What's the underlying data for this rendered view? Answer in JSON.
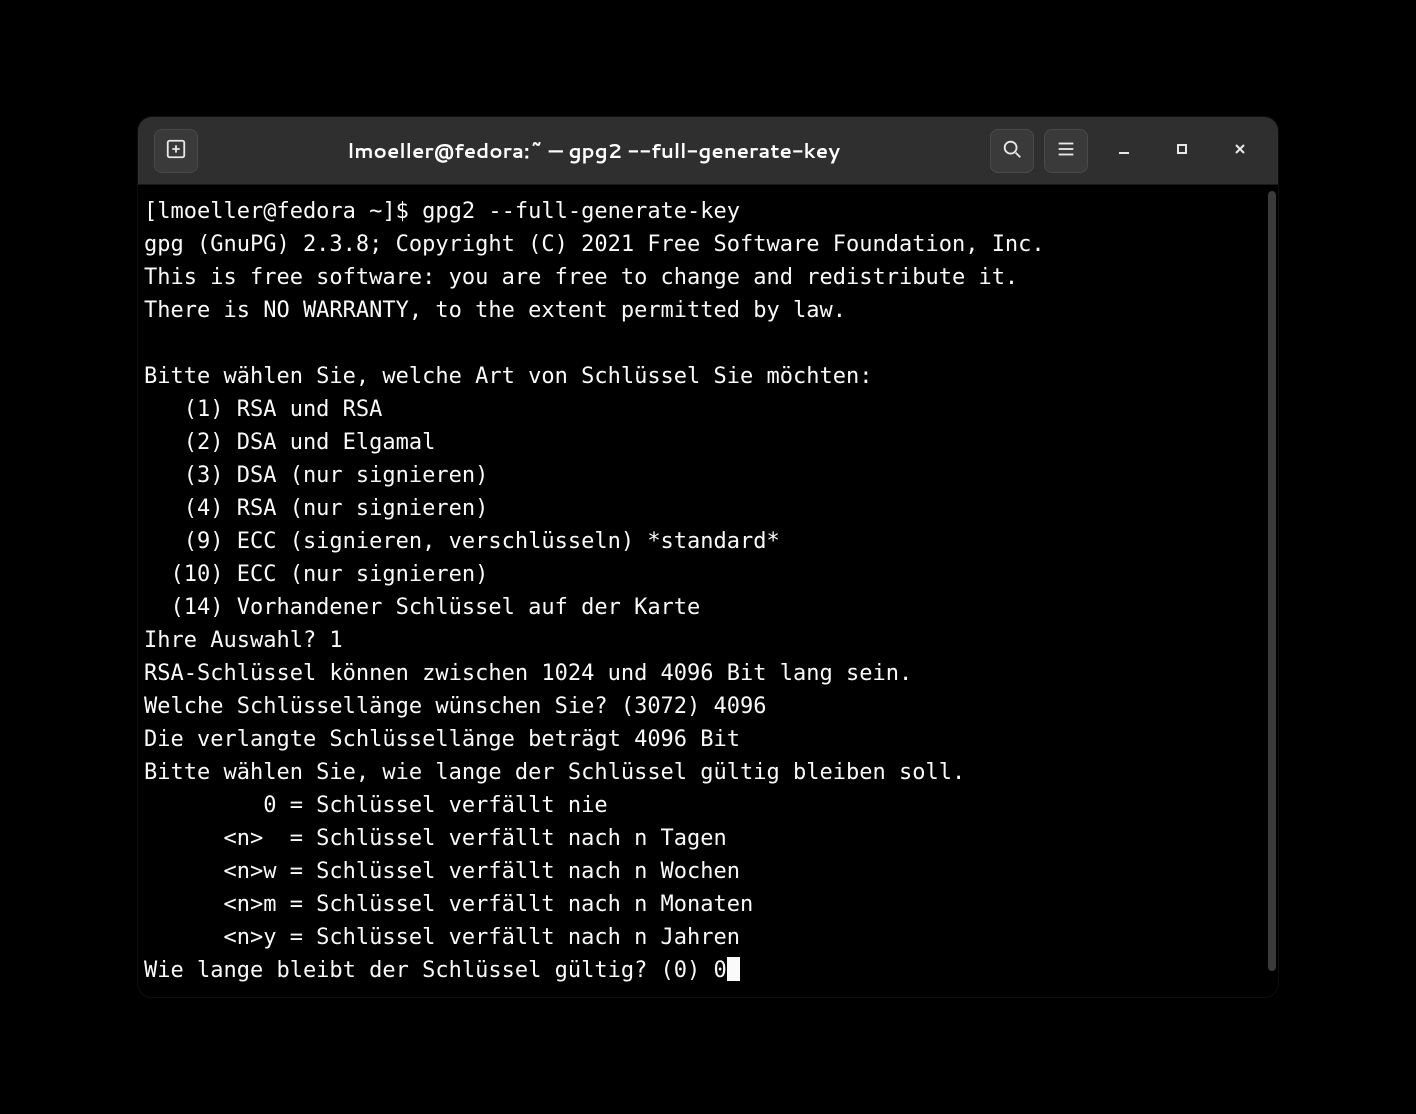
{
  "window": {
    "title": "lmoeller@fedora:~ — gpg2 --full-generate-key"
  },
  "icons": {
    "new_tab": "plus-box-icon",
    "search": "search-icon",
    "menu": "hamburger-icon",
    "minimize": "minimize-icon",
    "maximize": "maximize-icon",
    "close": "close-icon"
  },
  "terminal": {
    "lines": [
      "[lmoeller@fedora ~]$ gpg2 --full-generate-key",
      "gpg (GnuPG) 2.3.8; Copyright (C) 2021 Free Software Foundation, Inc.",
      "This is free software: you are free to change and redistribute it.",
      "There is NO WARRANTY, to the extent permitted by law.",
      "",
      "Bitte wählen Sie, welche Art von Schlüssel Sie möchten:",
      "   (1) RSA und RSA",
      "   (2) DSA und Elgamal",
      "   (3) DSA (nur signieren)",
      "   (4) RSA (nur signieren)",
      "   (9) ECC (signieren, verschlüsseln) *standard*",
      "  (10) ECC (nur signieren)",
      "  (14) Vorhandener Schlüssel auf der Karte",
      "Ihre Auswahl? 1",
      "RSA-Schlüssel können zwischen 1024 und 4096 Bit lang sein.",
      "Welche Schlüssellänge wünschen Sie? (3072) 4096",
      "Die verlangte Schlüssellänge beträgt 4096 Bit",
      "Bitte wählen Sie, wie lange der Schlüssel gültig bleiben soll.",
      "         0 = Schlüssel verfällt nie",
      "      <n>  = Schlüssel verfällt nach n Tagen",
      "      <n>w = Schlüssel verfällt nach n Wochen",
      "      <n>m = Schlüssel verfällt nach n Monaten",
      "      <n>y = Schlüssel verfällt nach n Jahren",
      "Wie lange bleibt der Schlüssel gültig? (0) 0"
    ]
  }
}
